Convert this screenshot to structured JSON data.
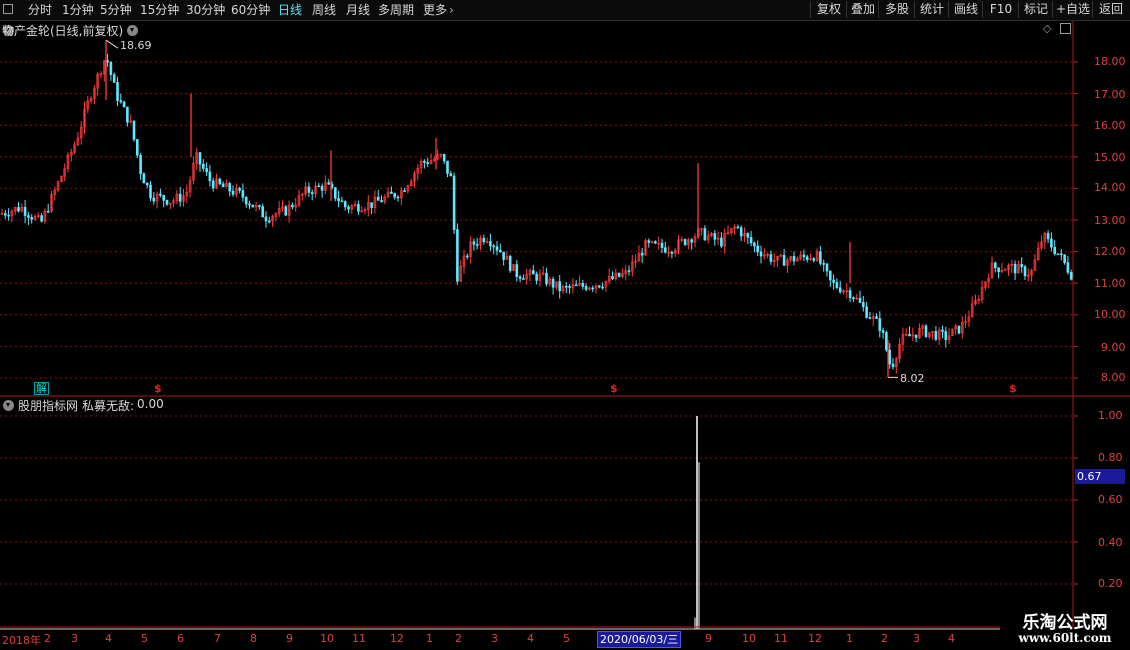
{
  "toolbar": {
    "periods": [
      {
        "label": "分时",
        "active": false
      },
      {
        "label": "1分钟",
        "active": false
      },
      {
        "label": "5分钟",
        "active": false
      },
      {
        "label": "15分钟",
        "active": false
      },
      {
        "label": "30分钟",
        "active": false
      },
      {
        "label": "60分钟",
        "active": false
      },
      {
        "label": "日线",
        "active": true
      },
      {
        "label": "周线",
        "active": false
      },
      {
        "label": "月线",
        "active": false
      },
      {
        "label": "多周期",
        "active": false
      },
      {
        "label": "更多",
        "active": false
      }
    ],
    "right_buttons": [
      "复权",
      "叠加",
      "多股",
      "统计",
      "画线",
      "F10",
      "标记",
      "+自选",
      "返回"
    ]
  },
  "main_chart": {
    "title": "物产金轮(日线,前复权)",
    "high_label": "18.69",
    "low_label": "8.02",
    "y_axis_labels": [
      "18.00",
      "17.00",
      "16.00",
      "15.00",
      "14.00",
      "13.00",
      "12.00",
      "11.00",
      "10.00",
      "9.00",
      "8.00"
    ],
    "markers": [
      "$",
      "$",
      "$"
    ],
    "event_badge": "解",
    "colors": {
      "up": "#ff3b3b",
      "down": "#5fe8ff",
      "grid": "#8a1010",
      "axis_text": "#e04040"
    }
  },
  "indicator": {
    "source_label": "股朋指标网",
    "name": "私募无敌:",
    "value": "0.00",
    "y_axis_labels": [
      "1.00",
      "0.80",
      "0.60",
      "0.40",
      "0.20"
    ],
    "current_value_badge": "0.67"
  },
  "date_axis": {
    "labels": [
      "2018年",
      "2",
      "3",
      "4",
      "5",
      "6",
      "7",
      "8",
      "9",
      "10",
      "11",
      "12",
      "1",
      "2",
      "3",
      "4",
      "5",
      "9",
      "10",
      "11",
      "12",
      "1",
      "2",
      "3",
      "4"
    ],
    "highlight": "2020/06/03/三"
  },
  "watermark": {
    "line1": "乐淘公式网",
    "line2": "www.60lt.com"
  }
}
